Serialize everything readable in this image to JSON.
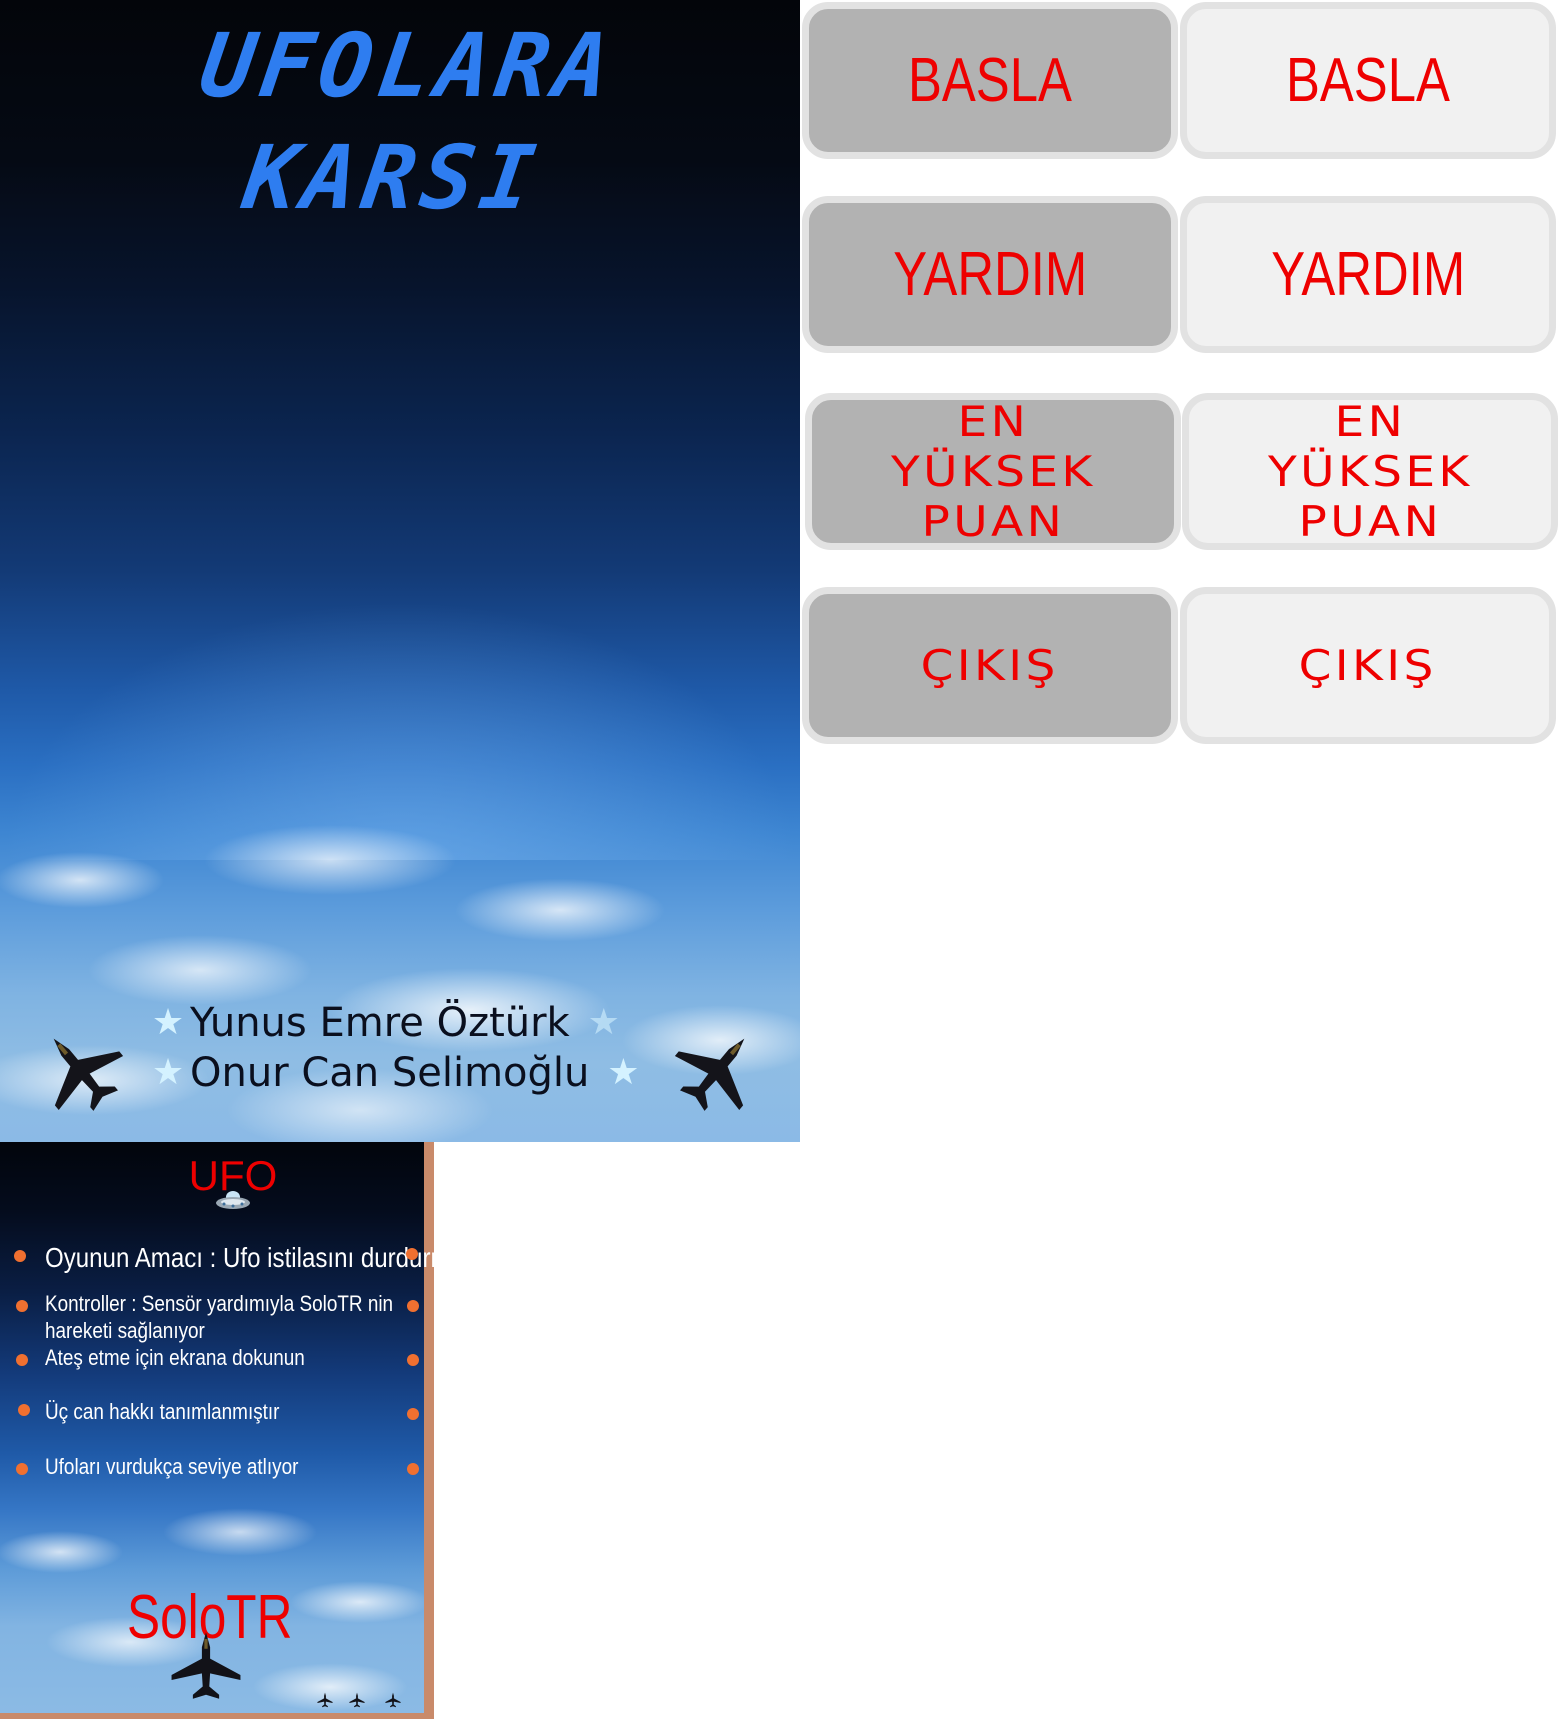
{
  "title_screen": {
    "title_line1": "UFOLARA",
    "title_line2": "KARSI",
    "credits": [
      "Yunus Emre Öztürk",
      "Onur Can Selimoğlu"
    ],
    "title_color": "#2e7df0"
  },
  "menu": {
    "pressed": {
      "start_label": "BASLA",
      "help_label": "YARDIM",
      "highscore_line1": "EN",
      "highscore_line2": "YÜKSEK",
      "highscore_line3": "PUAN",
      "exit_label": "ÇIKIŞ"
    },
    "normal": {
      "start_label": "BASLA",
      "help_label": "YARDIM",
      "highscore_line1": "EN",
      "highscore_line2": "YÜKSEK",
      "highscore_line3": "PUAN",
      "exit_label": "ÇIKIŞ"
    },
    "label_color": "#ee0000",
    "pressed_bg": "#b2b2b2",
    "normal_bg": "#f1f1f1"
  },
  "help_screen": {
    "ufo_title": "UFO",
    "items": [
      "Oyunun Amacı : Ufo istilasını durdurmak",
      "Kontroller : Sensör yardımıyla SoloTR nin",
      "hareketi sağlanıyor",
      "Ateş etme için ekrana dokunun",
      "Üç can hakkı tanımlanmıştır",
      "Ufoları vurdukça  seviye atlıyor"
    ],
    "brand": "SoloTR",
    "lives_icon": "jet-icon",
    "bullet_color": "#f07030"
  }
}
